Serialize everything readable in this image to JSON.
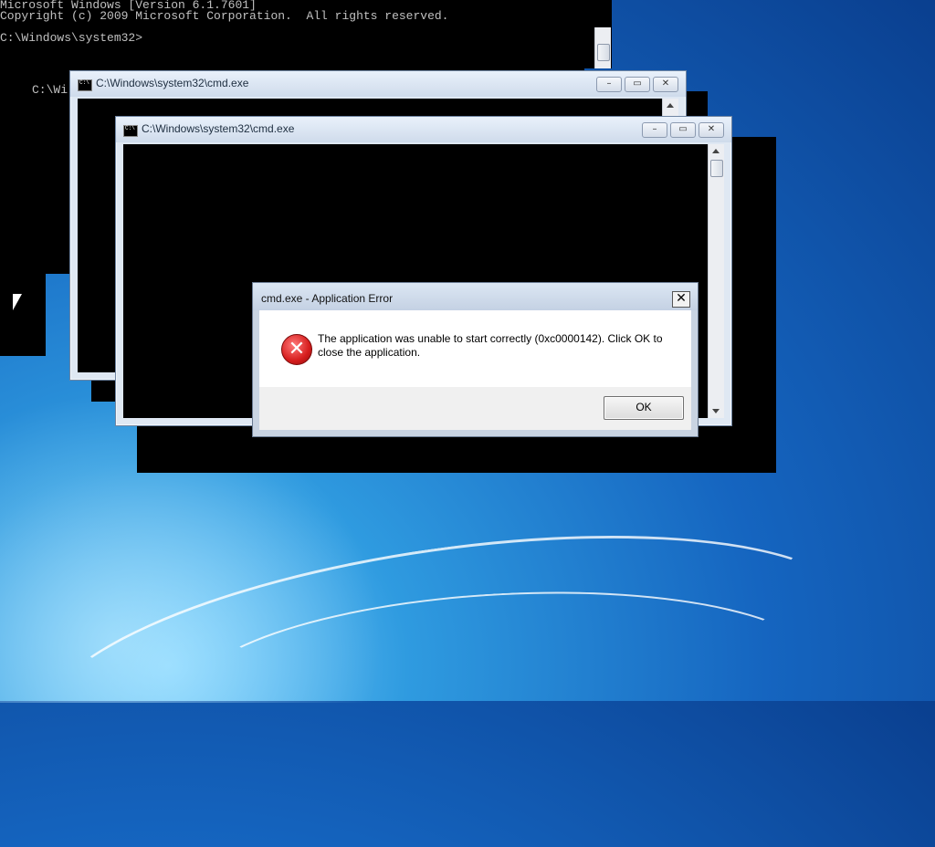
{
  "background_console": {
    "lines": [
      "Microsoft Windows [Version 6.1.7601]",
      "Copyright (c) 2009 Microsoft Corporation.  All rights reserved.",
      "",
      "C:\\Windows\\system32>"
    ],
    "partial_prompt": "C:\\Wi"
  },
  "windows": [
    {
      "title": "C:\\Windows\\system32\\cmd.exe"
    },
    {
      "title": "C:\\Windows\\system32\\cmd.exe"
    }
  ],
  "window_controls": {
    "minimize": "–",
    "maximize": "▭",
    "close": "✕"
  },
  "dialog": {
    "title": "cmd.exe - Application Error",
    "close_glyph": "✕",
    "icon": "error-icon",
    "icon_glyph": "✕",
    "message": "The application was unable to start correctly (0xc0000142). Click OK to close the application.",
    "ok_label": "OK"
  },
  "colors": {
    "error_red": "#d61d1d",
    "desktop_blue": "#1565c0"
  }
}
